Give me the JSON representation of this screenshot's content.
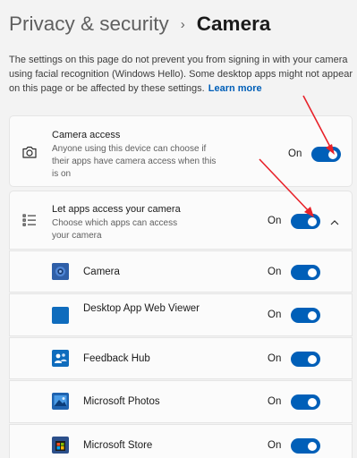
{
  "breadcrumb": {
    "parent": "Privacy & security",
    "separator": "›",
    "current": "Camera"
  },
  "info": {
    "text": "The settings on this page do not prevent you from signing in with your camera using facial recognition (Windows Hello). Some desktop apps might not appear on this page or be affected by these settings.",
    "link": "Learn more"
  },
  "camera_access": {
    "icon": "camera-icon",
    "title": "Camera access",
    "description": "Anyone using this device can choose if their apps have camera access when this is on",
    "state_label": "On",
    "enabled": true
  },
  "apps_access": {
    "icon": "list-icon",
    "title": "Let apps access your camera",
    "description": "Choose which apps can access your camera",
    "state_label": "On",
    "enabled": true,
    "expanded": true
  },
  "apps": [
    {
      "name": "Camera",
      "state_label": "On",
      "enabled": true,
      "icon": "camera-app-icon",
      "color": "#0f6cbd"
    },
    {
      "name": "Desktop App Web Viewer",
      "state_label": "On",
      "enabled": true,
      "icon": "desktop-app-web-viewer-icon",
      "color": "#0f6cbd"
    },
    {
      "name": "Feedback Hub",
      "state_label": "On",
      "enabled": true,
      "icon": "feedback-hub-icon",
      "color": "#0f6cbd"
    },
    {
      "name": "Microsoft Photos",
      "state_label": "On",
      "enabled": true,
      "icon": "photos-icon",
      "color": "#0f6cbd"
    },
    {
      "name": "Microsoft Store",
      "state_label": "On",
      "enabled": true,
      "icon": "store-icon",
      "color": "#0f6cbd"
    }
  ],
  "colors": {
    "accent": "#005fb8",
    "annotation_arrow": "#e8222a"
  }
}
